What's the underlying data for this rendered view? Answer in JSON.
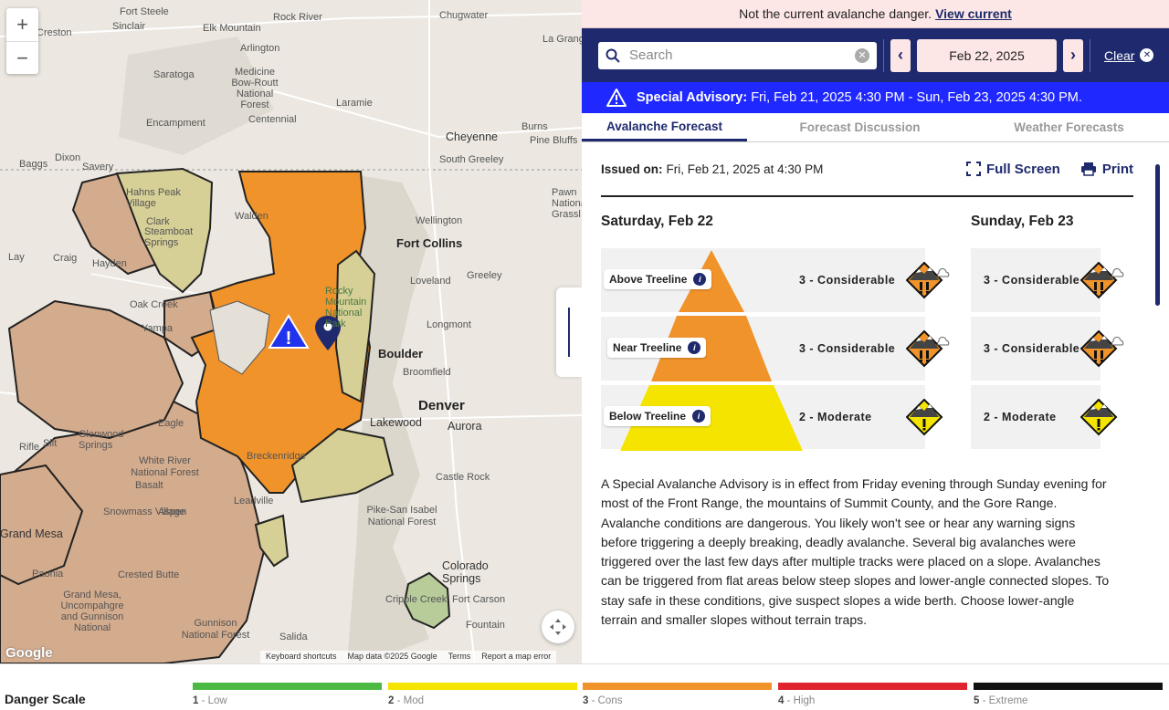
{
  "map": {
    "zoom_in": "+",
    "zoom_out": "−",
    "labels": {
      "fort_steele": "Fort Steele",
      "rock_river": "Rock River",
      "chugwater": "Chugwater",
      "sinclair": "Sinclair",
      "creston": "Creston",
      "elk_mountain": "Elk Mountain",
      "la_grange": "La Grange",
      "arlington": "Arlington",
      "saratoga": "Saratoga",
      "medicine_bow": "Medicine Bow-Routt National Forest",
      "laramie": "Laramie",
      "encampment": "Encampment",
      "centennial": "Centennial",
      "burns": "Burns",
      "pine_bluffs": "Pine Bluffs",
      "cheyenne": "Cheyenne",
      "baggs": "Baggs",
      "dixon": "Dixon",
      "savery": "Savery",
      "south_greeley": "South Greeley",
      "hahns_peak": "Hahns Peak Village",
      "clark": "Clark",
      "walden": "Walden",
      "pawn": "Pawn National Grassl",
      "wellington": "Wellington",
      "fort_collins": "Fort Collins",
      "steamboat": "Steamboat Springs",
      "lay": "Lay",
      "craig": "Craig",
      "hayden": "Hayden",
      "loveland": "Loveland",
      "greeley": "Greeley",
      "rocky": "Rocky Mountain National Park",
      "oak_creek": "Oak Creek",
      "yampa": "Yampa",
      "longmont": "Longmont",
      "boulder": "Boulder",
      "broomfield": "Broomfield",
      "denver": "Denver",
      "lakewood": "Lakewood",
      "aurora": "Aurora",
      "eagle": "Eagle",
      "glenwood": "Glenwood Springs",
      "rifle": "Rifle",
      "silt": "Silt",
      "white_river": "White River National Forest",
      "basalt": "Basalt",
      "castle_rock": "Castle Rock",
      "breckenridge": "Breckenridge",
      "leadville": "Leadville",
      "snowmass": "Snowmass Village",
      "aspen": "Aspen",
      "grand_mesa": "Grand Mesa",
      "pike": "Pike-San Isabel National Forest",
      "paonia": "Paonia",
      "crested_butte": "Crested Butte",
      "gm_unc": "Grand Mesa, Uncompahgre and Gunnison National",
      "colorado_springs": "Colorado Springs",
      "cripple_creek": "Cripple Creek",
      "fort_carson": "Fort Carson",
      "gunnison_nf": "Gunnison National Forest",
      "salida": "Salida",
      "fountain": "Fountain"
    },
    "google": "Google",
    "footer": {
      "shortcuts": "Keyboard shortcuts",
      "map_data": "Map data ©2025 Google",
      "terms": "Terms",
      "report": "Report a map error"
    },
    "zone_colors": {
      "considerable": "#f0932b",
      "moderate_low": "#d6cf96",
      "low": "#b8cc9a",
      "no_rating": "#d3ab8d"
    }
  },
  "notice": {
    "text": "Not the current avalanche danger.",
    "link": "View current"
  },
  "toolbar": {
    "search_placeholder": "Search",
    "date": "Feb 22, 2025",
    "clear": "Clear"
  },
  "advisory": {
    "label": "Special Advisory:",
    "text": "Fri, Feb 21, 2025 4:30 PM - Sun, Feb 23, 2025 4:30 PM."
  },
  "tabs": [
    "Avalanche Forecast",
    "Forecast Discussion",
    "Weather Forecasts"
  ],
  "forecast": {
    "issued_label": "Issued on:",
    "issued_value": "Fri, Feb 21, 2025 at 4:30 PM",
    "full_screen": "Full Screen",
    "print": "Print",
    "day1": "Saturday, Feb 22",
    "day2": "Sunday, Feb 23",
    "levels": [
      "Above Treeline",
      "Near Treeline",
      "Below Treeline"
    ],
    "day1_ratings": [
      "3 - Considerable",
      "3 - Considerable",
      "2 - Moderate"
    ],
    "day2_ratings": [
      "3 - Considerable",
      "3 - Considerable",
      "2 - Moderate"
    ],
    "colors": {
      "considerable": "#f0932b",
      "moderate": "#f5e400"
    }
  },
  "summary": "A Special Avalanche Advisory is in effect from Friday evening through Sunday evening for most of the Front Range, the mountains of Summit County, and the Gore Range. Avalanche conditions are dangerous. You likely won't see or hear any warning signs before triggering a deeply breaking, deadly avalanche. Several big avalanches were triggered over the last few days after multiple tracks were placed on a slope. Avalanches can be triggered from flat areas below steep slopes and lower-angle connected slopes. To stay safe in these conditions, give suspect slopes a wide berth. Choose lower-angle terrain and smaller slopes without terrain traps.",
  "danger_scale": {
    "title": "Danger Scale",
    "items": [
      {
        "num": "1",
        "label": " - Low",
        "color": "#4cb944"
      },
      {
        "num": "2",
        "label": " - Mod",
        "color": "#f5e400"
      },
      {
        "num": "3",
        "label": " - Cons",
        "color": "#f0932b"
      },
      {
        "num": "4",
        "label": " - High",
        "color": "#e0242f"
      },
      {
        "num": "5",
        "label": " - Extreme",
        "color": "#111111"
      }
    ]
  }
}
